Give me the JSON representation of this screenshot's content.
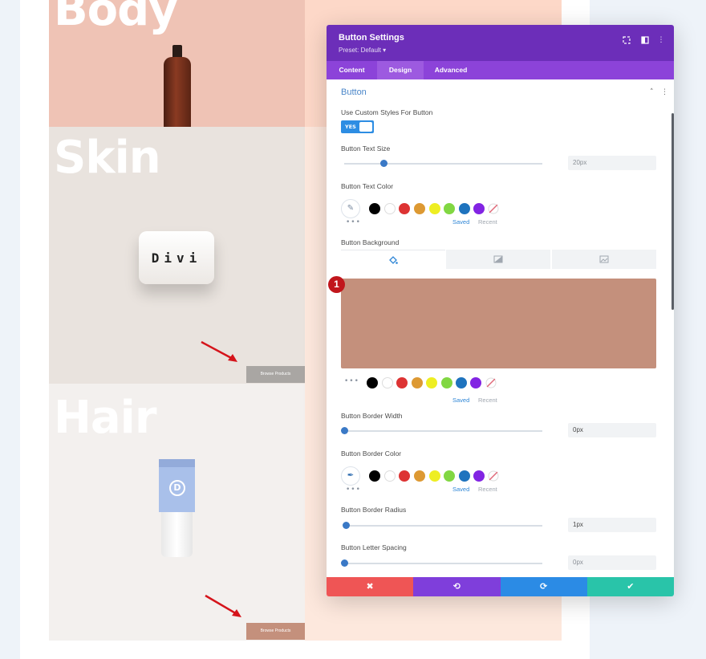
{
  "canvas": {
    "sections": [
      {
        "title": "Body"
      },
      {
        "title": "Skin",
        "product_label": "Divi",
        "button": "Browse Products"
      },
      {
        "title": "Hair",
        "product_logo": "D",
        "button": "Browse Products"
      }
    ]
  },
  "modal": {
    "title": "Button Settings",
    "preset": "Preset: Default ▾",
    "header_icons": [
      "fullscreen-icon",
      "split-view-icon",
      "more-options-icon"
    ],
    "tabs": [
      {
        "label": "Content",
        "active": false
      },
      {
        "label": "Design",
        "active": true
      },
      {
        "label": "Advanced",
        "active": false
      }
    ],
    "group": {
      "title": "Button",
      "collapse_icon": "˄",
      "menu_icon": "⋮"
    },
    "fields": {
      "custom_styles": {
        "label": "Use Custom Styles For Button",
        "toggle": "YES",
        "on": true
      },
      "text_size": {
        "label": "Button Text Size",
        "value": "20px",
        "slider_fraction": 0.2
      },
      "text_color": {
        "label": "Button Text Color",
        "saved": "Saved",
        "recent": "Recent",
        "dots": "•••"
      },
      "background": {
        "label": "Button Background",
        "tabs": [
          "fill-icon",
          "gradient-icon",
          "image-icon"
        ],
        "preview_color": "#c4907c",
        "badge": "1",
        "saved": "Saved",
        "recent": "Recent",
        "dots": "•••"
      },
      "border_width": {
        "label": "Button Border Width",
        "value": "0px",
        "slider_fraction": 0.0
      },
      "border_color": {
        "label": "Button Border Color",
        "saved": "Saved",
        "recent": "Recent",
        "dots": "•••"
      },
      "border_radius": {
        "label": "Button Border Radius",
        "value": "1px",
        "slider_fraction": 0.01
      },
      "letter_spacing": {
        "label": "Button Letter Spacing",
        "value": "0px",
        "slider_fraction": 0.0
      }
    },
    "palette": [
      "#000000",
      "#ffffff",
      "#dd3333",
      "#dd9933",
      "#eeee22",
      "#81d742",
      "#1e73be",
      "#8224e3"
    ],
    "footer": {
      "cancel": "✖",
      "undo": "⟲",
      "redo": "⟳",
      "save": "✔",
      "colors": {
        "cancel": "#ef5555",
        "undo": "#7f3edb",
        "redo": "#2b8be5",
        "save": "#29c4a9"
      }
    },
    "colors": {
      "header": "#6c2eb9",
      "tabs": "#8c43d9",
      "accent_blue": "#2d8de3",
      "title_blue": "#4a86c9"
    }
  }
}
